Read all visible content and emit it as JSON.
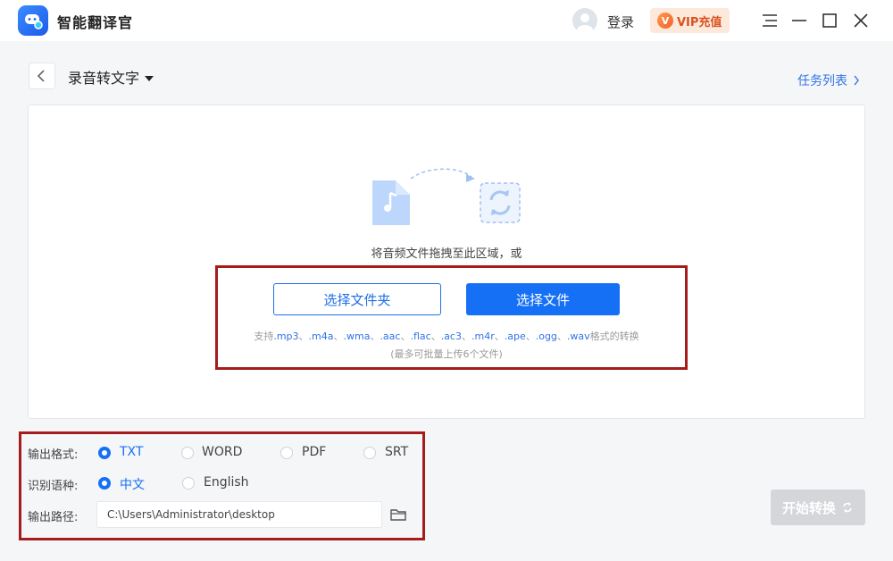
{
  "app": {
    "title": "智能翻译官"
  },
  "titlebar": {
    "login_label": "登录",
    "vip_badge": "V",
    "vip_label": "VIP充值"
  },
  "header": {
    "page_title": "录音转文字",
    "task_list_label": "任务列表"
  },
  "drop_area": {
    "hint": "将音频文件拖拽至此区域，或",
    "select_folder_label": "选择文件夹",
    "select_file_label": "选择文件",
    "support_prefix": "支持",
    "formats": [
      ".mp3",
      ".m4a",
      ".wma",
      ".aac",
      ".flac",
      ".ac3",
      ".m4r",
      ".ape",
      ".ogg",
      ".wav"
    ],
    "format_separator": "、",
    "support_suffix": "格式的转换",
    "limit_note": "(最多可批量上传6个文件)"
  },
  "settings": {
    "output_format": {
      "label": "输出格式:",
      "options": [
        {
          "label": "TXT",
          "checked": true
        },
        {
          "label": "WORD",
          "checked": false
        },
        {
          "label": "PDF",
          "checked": false
        },
        {
          "label": "SRT",
          "checked": false
        }
      ]
    },
    "language": {
      "label": "识别语种:",
      "options": [
        {
          "label": "中文",
          "checked": true
        },
        {
          "label": "English",
          "checked": false
        }
      ]
    },
    "output_path": {
      "label": "输出路径:",
      "value": "C:\\Users\\Administrator\\desktop"
    }
  },
  "actions": {
    "start_label": "开始转换"
  },
  "colors": {
    "accent": "#1670f6",
    "highlight_border": "#a61b1b",
    "disabled_button": "#d4d6da"
  },
  "icons": [
    "app-logo-icon",
    "user-avatar-icon",
    "vip-icon",
    "menu-icon",
    "minimize-icon",
    "maximize-icon",
    "close-icon",
    "back-arrow-icon",
    "caret-down-icon",
    "chevron-right-icon",
    "audio-file-icon",
    "convert-icon",
    "folder-icon",
    "refresh-icon"
  ]
}
